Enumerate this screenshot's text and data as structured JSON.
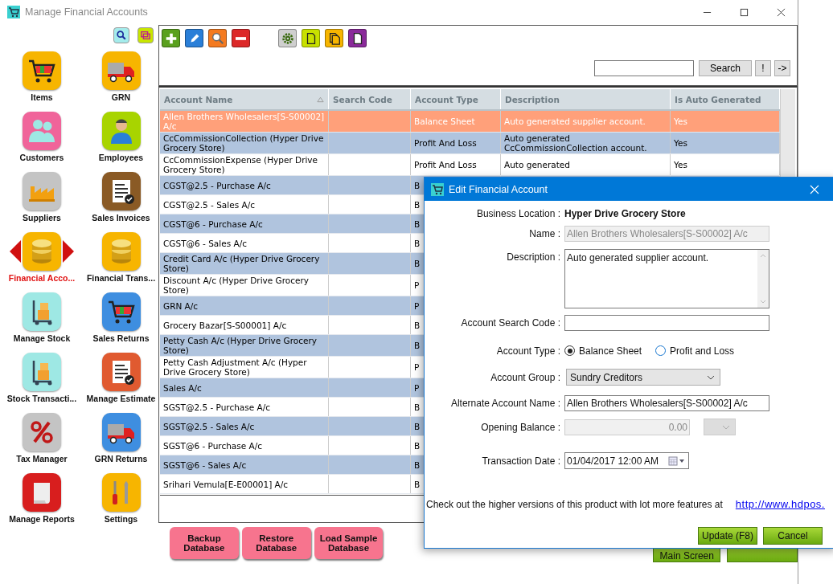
{
  "window": {
    "title": "Manage Financial Accounts"
  },
  "sidebar": {
    "items": [
      {
        "label": "Items",
        "selected": false
      },
      {
        "label": "GRN",
        "selected": false
      },
      {
        "label": "Customers",
        "selected": false
      },
      {
        "label": "Employees",
        "selected": false
      },
      {
        "label": "Suppliers",
        "selected": false
      },
      {
        "label": "Sales Invoices",
        "selected": false
      },
      {
        "label": "Financial Acco...",
        "selected": true
      },
      {
        "label": "Financial Trans...",
        "selected": false
      },
      {
        "label": "Manage Stock",
        "selected": false
      },
      {
        "label": "Sales Returns",
        "selected": false
      },
      {
        "label": "Stock Transacti...",
        "selected": false
      },
      {
        "label": "Manage Estimate",
        "selected": false
      },
      {
        "label": "Tax Manager",
        "selected": false
      },
      {
        "label": "GRN Returns",
        "selected": false
      },
      {
        "label": "Manage Reports",
        "selected": false
      },
      {
        "label": "Settings",
        "selected": false
      }
    ]
  },
  "toolbar": {
    "search_button": "Search",
    "buttons": [
      "!",
      "->"
    ]
  },
  "table": {
    "columns": [
      "Account Name",
      "Search Code",
      "Account Type",
      "Description",
      "Is Auto Generated"
    ],
    "rows": [
      {
        "name": "Allen Brothers Wholesalers[S-S00002] A/c",
        "type": "Balance Sheet",
        "description": "Auto generated supplier account.",
        "auto": "Yes",
        "selected": true
      },
      {
        "name": "CcCommissionCollection (Hyper Drive Grocery Store)",
        "type": "Profit And Loss",
        "description": "Auto generated CcCommissionCollection account.",
        "auto": "Yes",
        "selected": false
      },
      {
        "name": "CcCommissionExpense (Hyper Drive Grocery Store)",
        "type": "Profit And Loss",
        "description": "Auto generated",
        "auto": "Yes",
        "selected": false
      },
      {
        "name": "CGST@2.5 - Purchase A/c",
        "type": "B",
        "selected": false
      },
      {
        "name": "CGST@2.5 - Sales A/c",
        "type": "B",
        "selected": false
      },
      {
        "name": "CGST@6 - Purchase A/c",
        "type": "B",
        "selected": false
      },
      {
        "name": "CGST@6 - Sales A/c",
        "type": "B",
        "selected": false
      },
      {
        "name": "Credit Card A/c (Hyper Drive Grocery Store)",
        "type": "B",
        "selected": false
      },
      {
        "name": "Discount A/c (Hyper Drive Grocery Store)",
        "type": "P",
        "selected": false
      },
      {
        "name": "GRN A/c",
        "type": "P",
        "selected": false
      },
      {
        "name": "Grocery Bazar[S-S00001] A/c",
        "type": "B",
        "selected": false
      },
      {
        "name": "Petty Cash A/c (Hyper Drive Grocery Store)",
        "type": "B",
        "selected": false
      },
      {
        "name": "Petty Cash Adjustment A/c (Hyper Drive Grocery Store)",
        "type": "P",
        "selected": false
      },
      {
        "name": "Sales A/c",
        "type": "P",
        "selected": false
      },
      {
        "name": "SGST@2.5 - Purchase A/c",
        "type": "B",
        "selected": false
      },
      {
        "name": "SGST@2.5 - Sales A/c",
        "type": "B",
        "selected": false
      },
      {
        "name": "SGST@6 - Purchase A/c",
        "type": "B",
        "selected": false
      },
      {
        "name": "SGST@6 - Sales A/c",
        "type": "B",
        "selected": false
      },
      {
        "name": "Srihari Vemula[E-E00001] A/c",
        "type": "B",
        "selected": false
      }
    ]
  },
  "bottom_buttons": [
    "Backup Database",
    "Restore Database",
    "Load Sample Database"
  ],
  "footer_button": "Main Screen",
  "dialog": {
    "title": "Edit Financial Account",
    "business_location": {
      "label": "Business Location :",
      "value": "Hyper Drive Grocery Store"
    },
    "name": {
      "label": "Name :",
      "value": "Allen Brothers Wholesalers[S-S00002] A/c",
      "disabled": true
    },
    "description": {
      "label": "Description :",
      "value": "Auto generated supplier account."
    },
    "search_code": {
      "label": "Account Search Code :"
    },
    "account_type": {
      "label": "Account Type :",
      "options": [
        {
          "label": "Balance Sheet",
          "selected": true
        },
        {
          "label": "Profit and Loss",
          "selected": false
        }
      ]
    },
    "account_group": {
      "label": "Account Group :",
      "value": "Sundry Creditors"
    },
    "alternate_name": {
      "label": "Alternate Account Name :",
      "value": "Allen Brothers Wholesalers[S-S00002] A/c"
    },
    "opening_balance": {
      "label": "Opening Balance :",
      "value": "0.00",
      "disabled": true
    },
    "transaction_date": {
      "label": "Transaction Date :",
      "value": "01/04/2017 12:00 AM"
    },
    "note": "Check out the higher versions of this product with lot more features at",
    "link": "http://www.hdpos.",
    "buttons": [
      "Update (F8)",
      "Cancel"
    ]
  }
}
